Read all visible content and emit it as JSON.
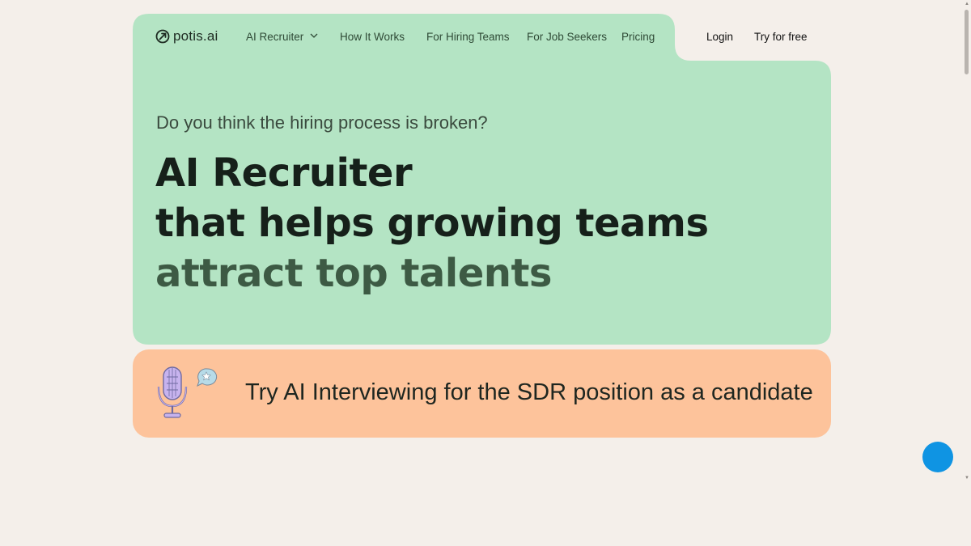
{
  "colors": {
    "page_bg": "#f4efea",
    "hero_bg": "#b4e4c4",
    "banner_bg": "#fdc39b",
    "accent_blue": "#0f94e3",
    "headline_dark": "#16201a",
    "headline_green": "#3d5a44"
  },
  "nav": {
    "logo_text": "potis.ai",
    "logo_icon": "potis-logo-icon",
    "links": [
      {
        "label": "AI Recruiter",
        "has_dropdown": true
      },
      {
        "label": "How It Works"
      },
      {
        "label": "For Hiring Teams"
      },
      {
        "label": "For Job Seekers"
      },
      {
        "label": "Pricing"
      }
    ],
    "login_label": "Login",
    "try_label": "Try for free"
  },
  "hero": {
    "eyebrow": "Do you think the hiring process is broken?",
    "headline_line1": "AI Recruiter",
    "headline_line2": "that helps growing teams",
    "headline_line3": "attract top talents"
  },
  "banner": {
    "icon": "microphone-icon",
    "text": "Try AI Interviewing for the SDR position as a candidate"
  },
  "chat_widget": {
    "icon": "chat-launcher"
  }
}
